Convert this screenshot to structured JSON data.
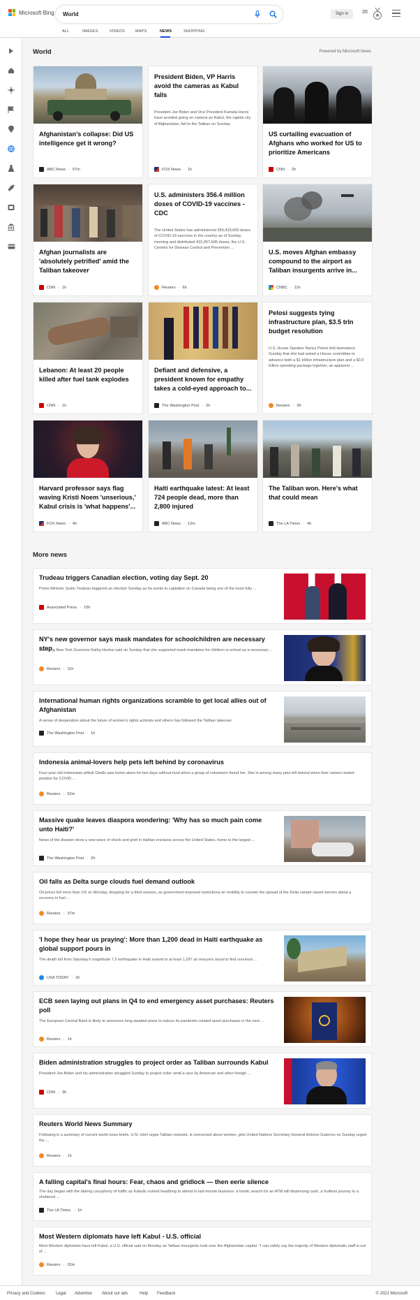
{
  "header": {
    "brand": "Microsoft Bing",
    "query": "World",
    "sign_in": "Sign in",
    "points": "20"
  },
  "nav": {
    "tabs": [
      "ALL",
      "IMAGES",
      "VIDEOS",
      "MAPS",
      "NEWS",
      "SHOPPING"
    ]
  },
  "world": {
    "title": "World",
    "powered": "Powered by Microsoft News"
  },
  "cards": [
    {
      "title": "Afghanistan's collapse: Did US intelligence get it wrong?",
      "snippet": "",
      "source": "ABC News",
      "time": "57m",
      "source_color": "#222"
    },
    {
      "title": "President Biden, VP Harris avoid the cameras as Kabul falls",
      "snippet": "President Joe Biden and Vice President Kamala Harris have avoided going on camera as Kabul, the capital city of Afghanistan, fell to the Taliban on Sunday.",
      "source": "FOX News",
      "time": "1h",
      "source_color": "#1a2b6d"
    },
    {
      "title": "US curtailing evacuation of Afghans who worked for US to prioritize Americans",
      "snippet": "",
      "source": "CNN",
      "time": "2h",
      "source_color": "#cc0000"
    },
    {
      "title": "Afghan journalists are 'absolutely petrified' amid the Taliban takeover",
      "snippet": "",
      "source": "CNN",
      "time": "1h",
      "source_color": "#cc0000"
    },
    {
      "title": "U.S. administers 356.4 million doses of COVID-19 vaccines - CDC",
      "snippet": "The United States has administered 356,433,665 doses of COVID-19 vaccines in the country as of Sunday morning and distributed 415,957,645 doses, the U.S. Centers for Disease Control and Prevention ...",
      "source": "Reuters",
      "time": "6h",
      "source_color": "#f08a24"
    },
    {
      "title": "U.S. moves Afghan embassy compound to the airport as Taliban insurgents arrive in...",
      "snippet": "",
      "source": "CNBC",
      "time": "11h",
      "source_color": "#2a9d8f"
    },
    {
      "title": "Lebanon: At least 20 people killed after fuel tank explodes",
      "snippet": "",
      "source": "CNN",
      "time": "1h",
      "source_color": "#cc0000"
    },
    {
      "title": "Defiant and defensive, a president known for empathy takes a cold-eyed approach to...",
      "snippet": "",
      "source": "The Washington Post",
      "time": "2h",
      "source_color": "#222"
    },
    {
      "title": "Pelosi suggests tying infrastructure plan, $3.5 trln budget resolution",
      "snippet": "U.S. House Speaker Nancy Pelosi told lawmakers Sunday that she had asked a House committee to advance both a $1 trillion infrastructure plan and a $3.5 trillion spending package together, an apparent ...",
      "source": "Reuters",
      "time": "9h",
      "source_color": "#f08a24"
    },
    {
      "title": "Harvard professor says flag waving Kristi Noem 'unserious,' Kabul crisis is 'what happens'...",
      "snippet": "",
      "source": "FOX News",
      "time": "4h",
      "source_color": "#1a2b6d"
    },
    {
      "title": "Haiti earthquake latest: At least 724 people dead, more than 2,800 injured",
      "snippet": "",
      "source": "ABC News",
      "time": "12m",
      "source_color": "#222"
    },
    {
      "title": "The Taliban won. Here's what that could mean",
      "snippet": "",
      "source": "The LA Times",
      "time": "4h",
      "source_color": "#222"
    }
  ],
  "more": {
    "title": "More news"
  },
  "rows": [
    {
      "title": "Trudeau triggers Canadian election, voting day Sept. 20",
      "snippet": "Prime Minister Justin Trudeau triggered an election Sunday as he seeks to capitalize on Canada being one of the most fully ...",
      "source": "Associated Press",
      "time": "10h",
      "source_color": "#cc0000"
    },
    {
      "title": "NY's new governor says mask mandates for schoolchildren are necessary step",
      "snippet": "Incoming New York Governor Kathy Hochul said on Sunday that she supported mask mandates for children in school as a necessary ...",
      "source": "Reuters",
      "time": "11h",
      "source_color": "#f08a24"
    },
    {
      "title": "International human rights organizations scramble to get local allies out of Afghanistan",
      "snippet": "A sense of desperation about the future of women's rights activists and others has followed the Taliban takeover.",
      "source": "The Washington Post",
      "time": "1h",
      "source_color": "#222"
    },
    {
      "title": "Indonesia animal-lovers help pets left behind by coronavirus",
      "snippet": "Four-year-old Indonesian pitbull Gledis was home alone for two days without food when a group of volunteers found her. She is among many pets left behind when their owners tested positive for COVID ...",
      "source": "Reuters",
      "time": "52m",
      "source_color": "#f08a24"
    },
    {
      "title": "Massive quake leaves diaspora wondering: 'Why has so much pain come unto Haiti?'",
      "snippet": "News of the disaster drew a new wave of shock and grief in Haitian enclaves across the United States, home to the largest ...",
      "source": "The Washington Post",
      "time": "2h",
      "source_color": "#222"
    },
    {
      "title": "Oil falls as Delta surge clouds fuel demand outlook",
      "snippet": "Oil prices fell more than 1% on Monday, dropping for a third session, as government-imposed restrictions on mobility to counter the spread of the Delta variant raised worries about a recovery in fuel ...",
      "source": "Reuters",
      "time": "37m",
      "source_color": "#f08a24"
    },
    {
      "title": "'I hope they hear us praying': More than 1,200 dead in Haiti earthquake as global support pours in",
      "snippet": "The death toll from Saturday's magnitude 7.2 earthquake in Haiti soared to at least 1,297 as rescuers raced to find survivors ...",
      "source": "USA TODAY",
      "time": "2h",
      "source_color": "#1e88e5"
    },
    {
      "title": "ECB seen laying out plans in Q4 to end emergency asset purchases: Reuters poll",
      "snippet": "The European Central Bank is likely to announce long-awaited plans to reduce its pandemic-related asset purchases in the next ...",
      "source": "Reuters",
      "time": "1h",
      "source_color": "#f08a24"
    },
    {
      "title": "Biden administration struggles to project order as Taliban surrounds Kabul",
      "snippet": "President Joe Biden and his administration struggled Sunday to project order amid a race by American and other foreign ...",
      "source": "CNN",
      "time": "3h",
      "source_color": "#cc0000"
    },
    {
      "title": "Reuters World News Summary",
      "snippet": "Following is a summary of current world news briefs. U.N. chief urges Taliban restraint, is concerned about women, girls United Nations Secretary-General Antonio Guterres on Sunday urged the ...",
      "source": "Reuters",
      "time": "1h",
      "source_color": "#f08a24"
    },
    {
      "title": "A falling capital's final hours: Fear, chaos and gridlock — then eerie silence",
      "snippet": "The day began with the blaring cacophony of traffic as Kabulis rushed headlong to attend to last-minute business: a frantic search for an ATM still dispensing cash, a fruitless journey to a shuttered ...",
      "source": "The LA Times",
      "time": "1h",
      "source_color": "#222"
    },
    {
      "title": "Most Western diplomats have left Kabul - U.S. official",
      "snippet": "Most Western diplomats have left Kabul, a U.S. official said on Monday as Taliban insurgents took over the Afghanistan capital. \"I can safely say the majority of Western diplomatic staff is out of ...",
      "source": "Reuters",
      "time": "32m",
      "source_color": "#f08a24"
    }
  ],
  "footer": {
    "links": [
      "Privacy and Cookies",
      "Legal",
      "Advertise",
      "About our ads",
      "Help",
      "Feedback"
    ],
    "copyright": "© 2021 Microsoft"
  }
}
